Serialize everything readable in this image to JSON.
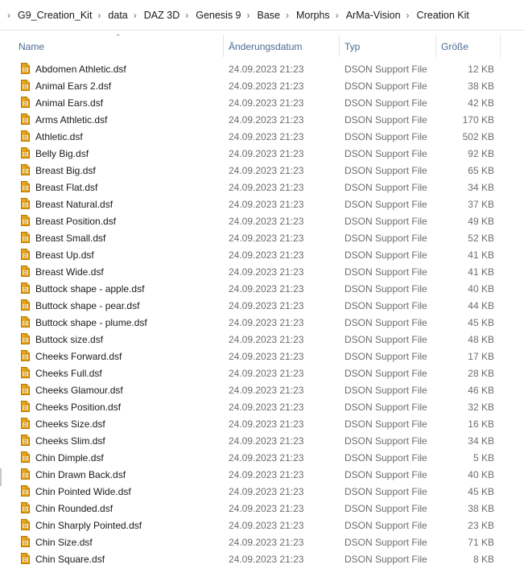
{
  "breadcrumb": {
    "separator": "›",
    "items": [
      "G9_Creation_Kit",
      "data",
      "DAZ 3D",
      "Genesis 9",
      "Base",
      "Morphs",
      "ArMa-Vision",
      "Creation Kit"
    ]
  },
  "columns": {
    "name": "Name",
    "date": "Änderungsdatum",
    "type": "Typ",
    "size": "Größe",
    "sorted_by": "name",
    "sort_direction": "ascending"
  },
  "file_icon": "dson-document-icon",
  "accent_color": "#e8a317",
  "files": [
    {
      "name": "Abdomen Athletic.dsf",
      "date": "24.09.2023 21:23",
      "type": "DSON Support File",
      "size": "12 KB"
    },
    {
      "name": "Animal Ears 2.dsf",
      "date": "24.09.2023 21:23",
      "type": "DSON Support File",
      "size": "38 KB"
    },
    {
      "name": "Animal Ears.dsf",
      "date": "24.09.2023 21:23",
      "type": "DSON Support File",
      "size": "42 KB"
    },
    {
      "name": "Arms Athletic.dsf",
      "date": "24.09.2023 21:23",
      "type": "DSON Support File",
      "size": "170 KB"
    },
    {
      "name": "Athletic.dsf",
      "date": "24.09.2023 21:23",
      "type": "DSON Support File",
      "size": "502 KB"
    },
    {
      "name": "Belly Big.dsf",
      "date": "24.09.2023 21:23",
      "type": "DSON Support File",
      "size": "92 KB"
    },
    {
      "name": "Breast Big.dsf",
      "date": "24.09.2023 21:23",
      "type": "DSON Support File",
      "size": "65 KB"
    },
    {
      "name": "Breast Flat.dsf",
      "date": "24.09.2023 21:23",
      "type": "DSON Support File",
      "size": "34 KB"
    },
    {
      "name": "Breast Natural.dsf",
      "date": "24.09.2023 21:23",
      "type": "DSON Support File",
      "size": "37 KB"
    },
    {
      "name": "Breast Position.dsf",
      "date": "24.09.2023 21:23",
      "type": "DSON Support File",
      "size": "49 KB"
    },
    {
      "name": "Breast Small.dsf",
      "date": "24.09.2023 21:23",
      "type": "DSON Support File",
      "size": "52 KB"
    },
    {
      "name": "Breast Up.dsf",
      "date": "24.09.2023 21:23",
      "type": "DSON Support File",
      "size": "41 KB"
    },
    {
      "name": "Breast Wide.dsf",
      "date": "24.09.2023 21:23",
      "type": "DSON Support File",
      "size": "41 KB"
    },
    {
      "name": "Buttock shape - apple.dsf",
      "date": "24.09.2023 21:23",
      "type": "DSON Support File",
      "size": "40 KB"
    },
    {
      "name": "Buttock shape - pear.dsf",
      "date": "24.09.2023 21:23",
      "type": "DSON Support File",
      "size": "44 KB"
    },
    {
      "name": "Buttock shape - plume.dsf",
      "date": "24.09.2023 21:23",
      "type": "DSON Support File",
      "size": "45 KB"
    },
    {
      "name": "Buttock size.dsf",
      "date": "24.09.2023 21:23",
      "type": "DSON Support File",
      "size": "48 KB"
    },
    {
      "name": "Cheeks Forward.dsf",
      "date": "24.09.2023 21:23",
      "type": "DSON Support File",
      "size": "17 KB"
    },
    {
      "name": "Cheeks Full.dsf",
      "date": "24.09.2023 21:23",
      "type": "DSON Support File",
      "size": "28 KB"
    },
    {
      "name": "Cheeks Glamour.dsf",
      "date": "24.09.2023 21:23",
      "type": "DSON Support File",
      "size": "46 KB"
    },
    {
      "name": "Cheeks Position.dsf",
      "date": "24.09.2023 21:23",
      "type": "DSON Support File",
      "size": "32 KB"
    },
    {
      "name": "Cheeks Size.dsf",
      "date": "24.09.2023 21:23",
      "type": "DSON Support File",
      "size": "16 KB"
    },
    {
      "name": "Cheeks Slim.dsf",
      "date": "24.09.2023 21:23",
      "type": "DSON Support File",
      "size": "34 KB"
    },
    {
      "name": "Chin Dimple.dsf",
      "date": "24.09.2023 21:23",
      "type": "DSON Support File",
      "size": "5 KB"
    },
    {
      "name": "Chin Drawn Back.dsf",
      "date": "24.09.2023 21:23",
      "type": "DSON Support File",
      "size": "40 KB"
    },
    {
      "name": "Chin Pointed Wide.dsf",
      "date": "24.09.2023 21:23",
      "type": "DSON Support File",
      "size": "45 KB"
    },
    {
      "name": "Chin Rounded.dsf",
      "date": "24.09.2023 21:23",
      "type": "DSON Support File",
      "size": "38 KB"
    },
    {
      "name": "Chin Sharply Pointed.dsf",
      "date": "24.09.2023 21:23",
      "type": "DSON Support File",
      "size": "23 KB"
    },
    {
      "name": "Chin Size.dsf",
      "date": "24.09.2023 21:23",
      "type": "DSON Support File",
      "size": "71 KB"
    },
    {
      "name": "Chin Square.dsf",
      "date": "24.09.2023 21:23",
      "type": "DSON Support File",
      "size": "8 KB"
    }
  ]
}
